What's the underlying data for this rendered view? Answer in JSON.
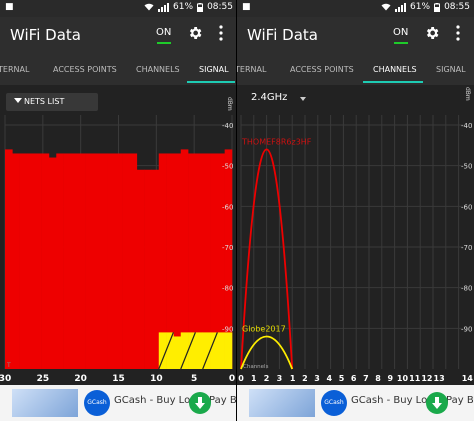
{
  "left": {
    "status": {
      "left": "■",
      "battery": "61%",
      "time": "08:55"
    },
    "app_title": "WiFi Data",
    "toggle_label": "ON",
    "tabs": [
      "TERNAL",
      "ACCESS POINTS",
      "CHANNELS",
      "SIGNAL"
    ],
    "active_tab": "SIGNAL",
    "nets_button": "NETS LIST",
    "ad": {
      "logo": "GCash",
      "text": "GCash - Buy Load, Pay Bills, Se..."
    }
  },
  "right": {
    "status": {
      "left": "■",
      "battery": "61%",
      "time": "08:55"
    },
    "app_title": "WiFi Data",
    "toggle_label": "ON",
    "tabs": [
      "TERNAL",
      "ACCESS POINTS",
      "CHANNELS",
      "SIGNAL"
    ],
    "active_tab": "CHANNELS",
    "band": "2.4GHz",
    "ad": {
      "logo": "GCash",
      "text": "GCash - Buy Load, Pay Bills, Se..."
    }
  },
  "colors": {
    "red": "#ee0000",
    "yellow": "#ffee00",
    "accent": "#1ecbb3",
    "green": "#1ecb2a",
    "label_red": "#cc1111",
    "label_yellow": "#e6dc00"
  },
  "chart_data": [
    {
      "type": "bar",
      "panel": "signal",
      "ylabel": "dBm",
      "y_ticks": [
        -40,
        -50,
        -60,
        -70,
        -80,
        -90
      ],
      "ylim": [
        -100,
        -40
      ],
      "x_ticks": [
        "30",
        "25",
        "20",
        "15",
        "10",
        "5",
        "0"
      ],
      "xlim": [
        30,
        0
      ],
      "series": [
        {
          "color_key": "red",
          "values": [
            -46,
            -47,
            -47,
            -47,
            -47,
            -47,
            -48,
            -47,
            -47,
            -47,
            -47,
            -47,
            -47,
            -47,
            -47,
            -47,
            -47,
            -47,
            -51,
            -51,
            -51,
            -47,
            -47,
            -47,
            -46,
            -47,
            -47,
            -47,
            -47,
            -47,
            -46
          ]
        },
        {
          "color_key": "yellow",
          "values": [
            null,
            null,
            null,
            null,
            null,
            null,
            null,
            null,
            null,
            null,
            null,
            null,
            null,
            null,
            null,
            null,
            null,
            null,
            null,
            null,
            null,
            -91,
            -91,
            -92,
            -91,
            -91,
            -91,
            -91,
            -91,
            -91,
            -91
          ]
        }
      ],
      "corner_label": "T"
    },
    {
      "type": "area",
      "panel": "channels",
      "ylabel": "dBm",
      "y_ticks": [
        -40,
        -50,
        -60,
        -70,
        -80,
        -90
      ],
      "ylim": [
        -100,
        -40
      ],
      "x_ticks": [
        "1",
        "2",
        "3",
        "4",
        "5",
        "6",
        "7",
        "8",
        "9",
        "10",
        "11",
        "12",
        "13",
        "14"
      ],
      "x_edge_ticks": [
        "0",
        "1",
        "2",
        "3"
      ],
      "x_axis_label": "Channels",
      "networks": [
        {
          "name": "THOMEF8R6z3HF",
          "channel": 1,
          "peak": -46,
          "color_key": "red"
        },
        {
          "name": "Globe2017",
          "channel": 1,
          "peak": -92,
          "color_key": "yellow"
        }
      ]
    }
  ]
}
